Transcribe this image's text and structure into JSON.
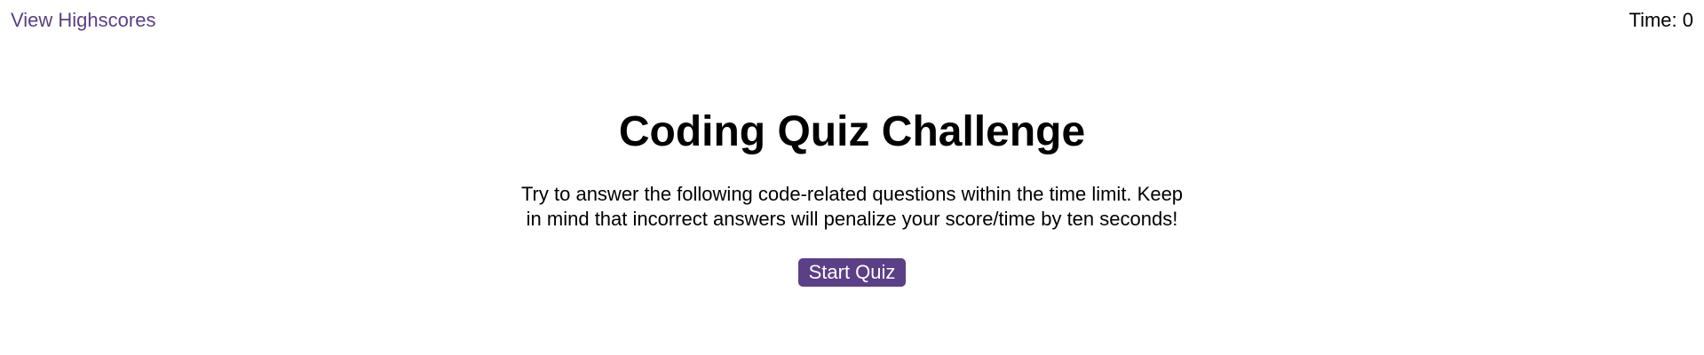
{
  "header": {
    "highscores_label": "View Highscores",
    "timer_label": "Time: 0"
  },
  "main": {
    "title": "Coding Quiz Challenge",
    "intro": "Try to answer the following code-related questions within the time limit. Keep in mind that incorrect answers will penalize your score/time by ten seconds!",
    "start_label": "Start Quiz"
  },
  "colors": {
    "accent": "#5b3f87",
    "button_text": "#ffffff",
    "text": "#000000",
    "background": "#ffffff"
  }
}
